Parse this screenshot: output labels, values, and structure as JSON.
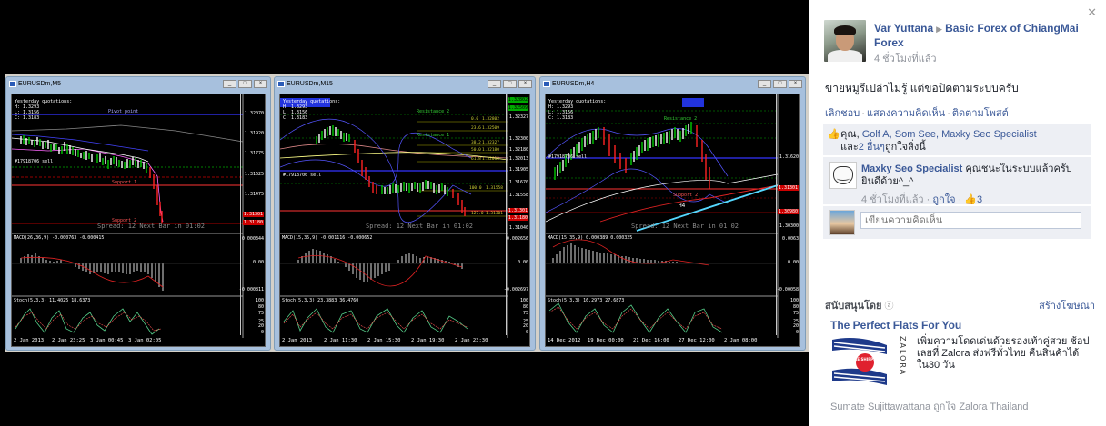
{
  "charts": [
    {
      "title": "EURUSDm,M5",
      "info": [
        "Yesterday quotations:",
        "H: 1.3293",
        "L: 1.3156",
        "C: 1.3183"
      ],
      "order_label": "#17918706 sell",
      "price_ticks": [
        "1.32070",
        "1.31920",
        "1.31775",
        "1.31625",
        "1.31475",
        "1.31301",
        "1.31180"
      ],
      "macd_label": "MACD(26,36,9) -0.000763 -0.000415",
      "macd_ticks": [
        "0.000344",
        "0.00",
        "-0.000811"
      ],
      "stoch_label": "Stoch(5,3,3) 11.4025 18.6373",
      "stoch_ticks": [
        "100",
        "80",
        "75",
        "25",
        "20",
        "0"
      ],
      "x_labels": [
        "2 Jan 2013",
        "2 Jan 23:25",
        "3 Jan 00:45",
        "3 Jan 02:05"
      ],
      "spread": "Spread: 12   Next Bar in 01:02",
      "levels": [
        "Pivot point",
        "Support 1",
        "Support 2"
      ]
    },
    {
      "title": "EURUSDm,M15",
      "info": [
        "Yesterday quotations:",
        "H: 1.3293",
        "L: 1.3156",
        "C: 1.3183"
      ],
      "order_label": "#17918706 sell",
      "price_ticks": [
        "1.32802",
        "1.32509",
        "1.32327",
        "1.32300",
        "1.32180",
        "1.32013",
        "1.31905",
        "1.31670",
        "1.31558",
        "1.31301",
        "1.31180",
        "1.31040"
      ],
      "macd_label": "MACD(15,35,9) -0.001116 -0.000652",
      "macd_ticks": [
        "0.002656",
        "0.00",
        "-0.002697"
      ],
      "stoch_label": "Stoch(5,3,3) 23.3883 36.4760",
      "stoch_ticks": [
        "100",
        "80",
        "75",
        "25",
        "20",
        "0"
      ],
      "x_labels": [
        "2 Jan 2013",
        "2 Jan 11:30",
        "2 Jan 15:30",
        "2 Jan 19:30",
        "2 Jan 23:30"
      ],
      "spread": "Spread: 12   Next Bar in 01:02",
      "levels": [
        "Resistance 2",
        "Resistance 1",
        "0.0",
        "23.6",
        "38.2",
        "50.0",
        "61.8",
        "100.0",
        "127.0"
      ],
      "fibo_vals": [
        "1.32802",
        "1.32509",
        "1.32327",
        "1.32180",
        "1.32013",
        "1.31558",
        "1.31301"
      ]
    },
    {
      "title": "EURUSDm,H4",
      "info": [
        "Yesterday quotations:",
        "H: 1.3293",
        "L: 1.3156",
        "C: 1.3183"
      ],
      "order_label": "#17918706 sell",
      "price_ticks": [
        "1.31620",
        "1.31301",
        "1.30980",
        "1.30300"
      ],
      "macd_label": "MACD(15,35,9) 0.000389 0.000325",
      "macd_ticks": [
        "0.0063",
        "0.00",
        "-0.00058"
      ],
      "stoch_label": "Stoch(5,3,3) 16.2973 27.6873",
      "stoch_ticks": [
        "100",
        "80",
        "75",
        "25",
        "20",
        "0"
      ],
      "x_labels": [
        "14 Dec 2012",
        "19 Dec 00:00",
        "21 Dec 16:00",
        "27 Dec 12:00",
        "2 Jan 08:00"
      ],
      "spread": "Spread: 12   Next Bar in 01:02",
      "levels": [
        "Resistance 2",
        "Support 2",
        "H4"
      ]
    }
  ],
  "post": {
    "author": "Var Yuttana",
    "group": "Basic Forex of ChiangMai Forex",
    "time": "4 ชั่วโมงที่แล้ว",
    "text": "ขายหมูรึเปล่าไม่รู้ แต่ขอปิดตามระบบครับ",
    "actions": [
      "เลิกชอบ",
      "แสดงความคิดเห็น",
      "ติดตามโพสต์"
    ],
    "likes_prefix": "คุณ, ",
    "likes_names": "Golf A, Som See, Maxky Seo Specialist",
    "likes_and": "และ",
    "likes_others": "2 อื่นๆ",
    "likes_suffix": "ถูกใจสิ่งนี้"
  },
  "comment": {
    "name": "Maxky Seo Specialist",
    "text": "คุณชนะในระบบแล้วครับ ยินดีด้วย^_^",
    "time": "4 ชั่วโมงที่แล้ว",
    "like": "ถูกใจ",
    "like_count": "3"
  },
  "write_comment_placeholder": "เขียนความคิดเห็น",
  "sponsored": {
    "label": "สนับสนุนโดย",
    "create_ad": "สร้างโฆษณา",
    "ad_title": "The Perfect Flats For You",
    "ad_text": "เพิ่มความโดดเด่นด้วยรองเท้าคู่สวย ช้อปเลยที่ Zalora ส่งฟรีทั่วไทย คืนสินค้าได้ใน30 วัน",
    "ad_badge": "FREE SHIPPING",
    "ad_brand": "ZALORA",
    "social": "Sumate Sujittawattana ถูกใจ Zalora Thailand"
  }
}
